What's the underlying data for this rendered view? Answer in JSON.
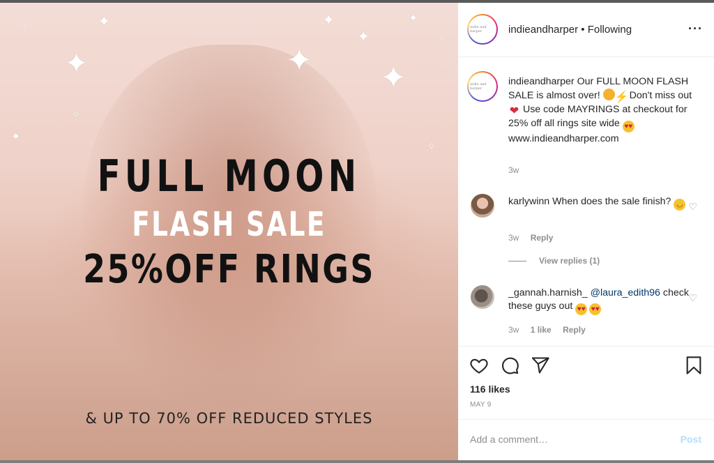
{
  "post": {
    "image": {
      "headline1": "FULL MOON",
      "headline2": "FLASH SALE",
      "headline3": "25%OFF RINGS",
      "footer": "& UP TO 70% OFF REDUCED STYLES",
      "bg_color": "#efd2c9"
    },
    "header": {
      "username": "indieandharper",
      "separator": "•",
      "follow_status": "Following",
      "more_icon": "more-horizontal-icon",
      "avatar_text": "indie and harper"
    },
    "caption": {
      "username": "indieandharper",
      "text_part1": "Our FULL MOON FLASH SALE is almost over!",
      "text_part2": "Don't miss out",
      "text_part3": "Use code MAYRINGS at checkout for 25% off all rings site wide",
      "text_part4": "www.indieandharper.com",
      "time": "3w"
    },
    "comments": [
      {
        "username": "karlywinn",
        "text": "When does the sale finish?",
        "time": "3w",
        "reply_label": "Reply",
        "view_replies": "View replies (1)"
      },
      {
        "username": "_gannah.harnish_",
        "mention": "@laura_edith96",
        "text": "check these guys out",
        "time": "3w",
        "likes": "1 like",
        "reply_label": "Reply"
      }
    ],
    "actions": {
      "likes": "116 likes",
      "date": "MAY 9",
      "icons": [
        "heart-icon",
        "comment-icon",
        "share-icon",
        "bookmark-icon"
      ]
    },
    "add_comment": {
      "placeholder": "Add a comment…",
      "post_label": "Post",
      "post_color": "#b2dffc"
    }
  }
}
